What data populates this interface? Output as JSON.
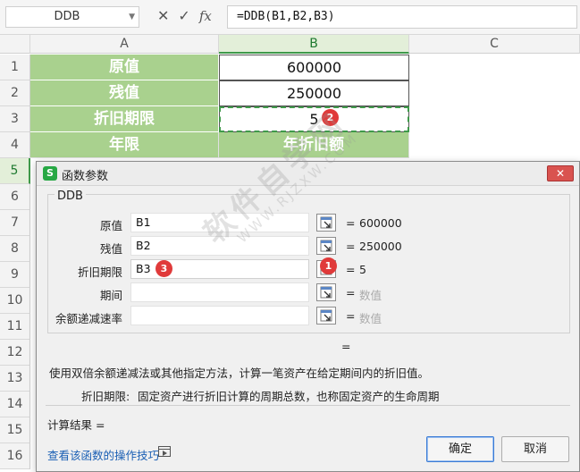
{
  "formula_bar": {
    "name_box": "DDB",
    "cancel_glyph": "✕",
    "enter_glyph": "✓",
    "fx_label": "fx",
    "formula": "=DDB(B1,B2,B3)"
  },
  "columns": [
    "A",
    "B",
    "C"
  ],
  "rows": [
    "1",
    "2",
    "3",
    "4",
    "5",
    "6",
    "7",
    "8",
    "9",
    "10",
    "11",
    "12",
    "13",
    "14",
    "15",
    "16"
  ],
  "cells": {
    "a1": "原值",
    "b1": "600000",
    "a2": "残值",
    "b2": "250000",
    "a3": "折旧期限",
    "b3": "5",
    "a4": "年限",
    "b4": "年折旧额"
  },
  "badges": {
    "one": "1",
    "two": "2",
    "three": "3"
  },
  "dialog": {
    "title": "函数参数",
    "close_glyph": "✕",
    "function_name": "DDB",
    "args": [
      {
        "label": "原值",
        "value": "B1",
        "eq": "=",
        "result": "600000"
      },
      {
        "label": "残值",
        "value": "B2",
        "eq": "=",
        "result": "250000"
      },
      {
        "label": "折旧期限",
        "value": "B3",
        "eq": "=",
        "result": "5"
      },
      {
        "label": "期间",
        "value": "",
        "eq": "=",
        "result": "数值"
      },
      {
        "label": "余额递减速率",
        "value": "",
        "eq": "=",
        "result": "数值"
      }
    ],
    "formula_result_eq": "=",
    "description": "使用双倍余额递减法或其他指定方法，计算一笔资产在给定期间内的折旧值。",
    "param_desc_label": "折旧期限:",
    "param_desc_text": "固定资产进行折旧计算的周期总数，也称固定资产的生命周期",
    "calc_result": "计算结果  =",
    "help_link": "查看该函数的操作技巧",
    "ok": "确定",
    "cancel": "取消"
  },
  "watermark": {
    "main": "软件自学网",
    "sub": "WWW.RJZXW.COM"
  },
  "colors": {
    "header_green": "#a9d18e",
    "badge_red": "#e03a3a",
    "accent_green": "#3f9a4a"
  }
}
